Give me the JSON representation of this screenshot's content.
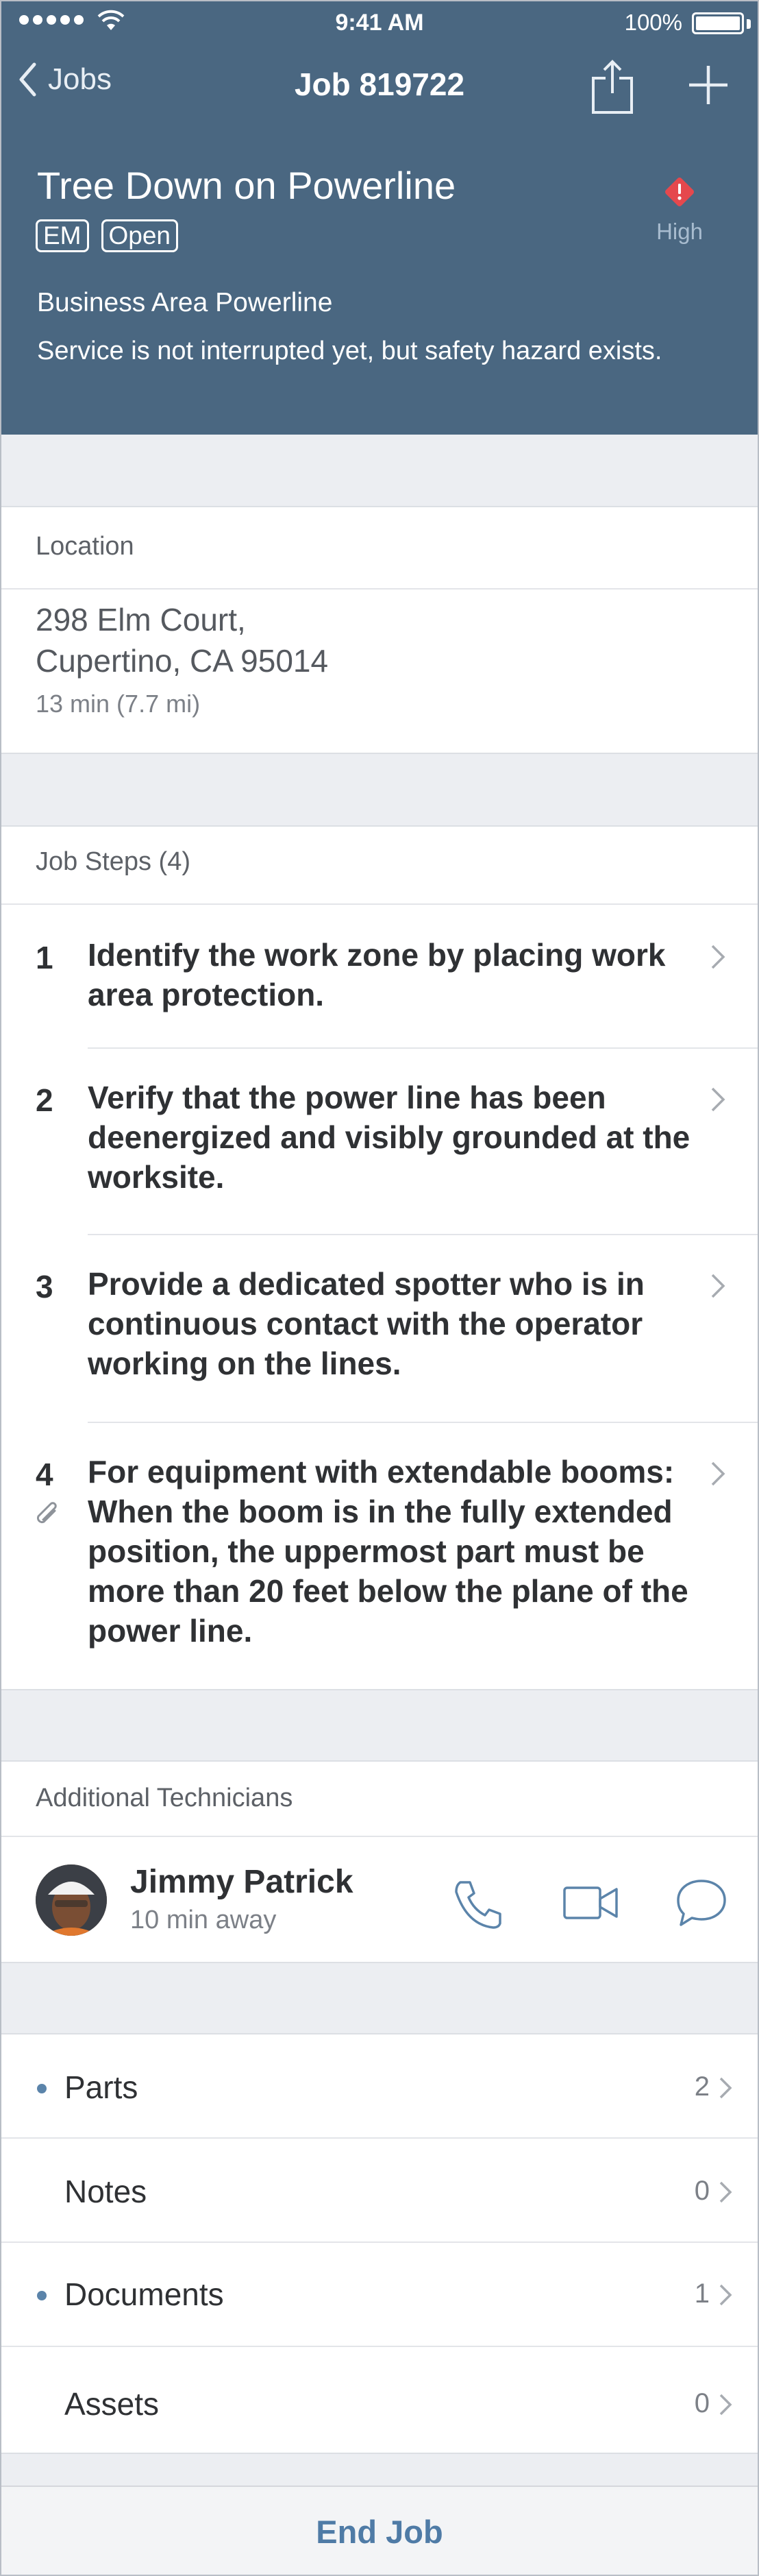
{
  "status_bar": {
    "time": "9:41 AM",
    "battery": "100%"
  },
  "nav": {
    "back_label": "Jobs",
    "title": "Job 819722"
  },
  "job": {
    "title": "Tree Down on Powerline",
    "badges": [
      "EM",
      "Open"
    ],
    "priority": "High",
    "area": "Business Area Powerline",
    "description": "Service is not interrupted yet, but safety hazard exists."
  },
  "location": {
    "label": "Location",
    "address_line1": "298 Elm Court,",
    "address_line2": "Cupertino, CA 95014",
    "eta": "13 min (7.7 mi)"
  },
  "steps": {
    "label": "Job Steps (4)",
    "items": [
      {
        "number": "1",
        "text": "Identify the work zone by placing work area protection.",
        "attachment": false
      },
      {
        "number": "2",
        "text": "Verify that the power line has been deenergized and visibly grounded at the worksite.",
        "attachment": false
      },
      {
        "number": "3",
        "text": "Provide a dedicated spotter who is in continuous contact with the operator working on the lines.",
        "attachment": false
      },
      {
        "number": "4",
        "text": "For equipment with extendable booms: When the boom is in the fully extended position, the uppermost part must be more than 20 feet below the plane of the power line.",
        "attachment": true
      }
    ]
  },
  "technicians": {
    "label": "Additional Technicians",
    "items": [
      {
        "name": "Jimmy Patrick",
        "eta": "10 min away"
      }
    ]
  },
  "links": [
    {
      "label": "Parts",
      "count": "2",
      "dot": true
    },
    {
      "label": "Notes",
      "count": "0",
      "dot": false
    },
    {
      "label": "Documents",
      "count": "1",
      "dot": true
    },
    {
      "label": "Assets",
      "count": "0",
      "dot": false
    }
  ],
  "footer": {
    "end_label": "End Job"
  },
  "colors": {
    "header_bg": "#4a6781",
    "accent": "#4f7ba6",
    "priority_red": "#e5484d"
  },
  "icons": [
    "back-chevron-icon",
    "share-icon",
    "add-icon",
    "alert-diamond-icon",
    "chevron-right-icon",
    "paperclip-icon",
    "phone-icon",
    "video-icon",
    "message-icon"
  ]
}
